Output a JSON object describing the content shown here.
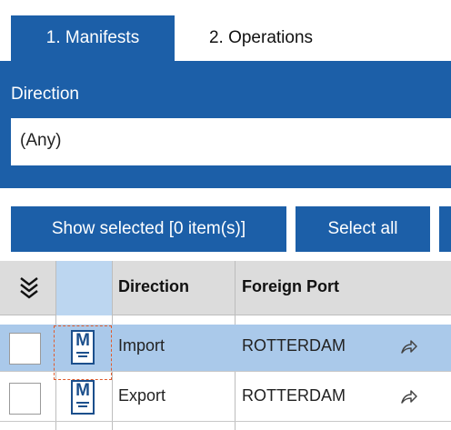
{
  "tabs": [
    {
      "label": "1. Manifests",
      "active": true
    },
    {
      "label": "2. Operations",
      "active": false
    }
  ],
  "filter": {
    "label": "Direction",
    "selected": "(Any)"
  },
  "toolbar": {
    "show_selected": "Show selected [0 item(s)]",
    "select_all": "Select all"
  },
  "grid": {
    "columns": [
      "Direction",
      "Foreign Port"
    ],
    "rows": [
      {
        "direction": "Import",
        "foreign_port": "ROTTERDAM",
        "selected": true,
        "icon_letter": "M"
      },
      {
        "direction": "Export",
        "foreign_port": "ROTTERDAM",
        "selected": false,
        "icon_letter": "M"
      }
    ]
  },
  "icons": {
    "expand": "double-chevron-down-icon",
    "manifest": "manifest-document-icon",
    "share": "share-arrow-icon"
  },
  "colors": {
    "primary": "#1c5fa8",
    "selected_row": "#aac9ea",
    "header_bg": "#dcdcdc",
    "focus_outline": "#e05a2b"
  }
}
